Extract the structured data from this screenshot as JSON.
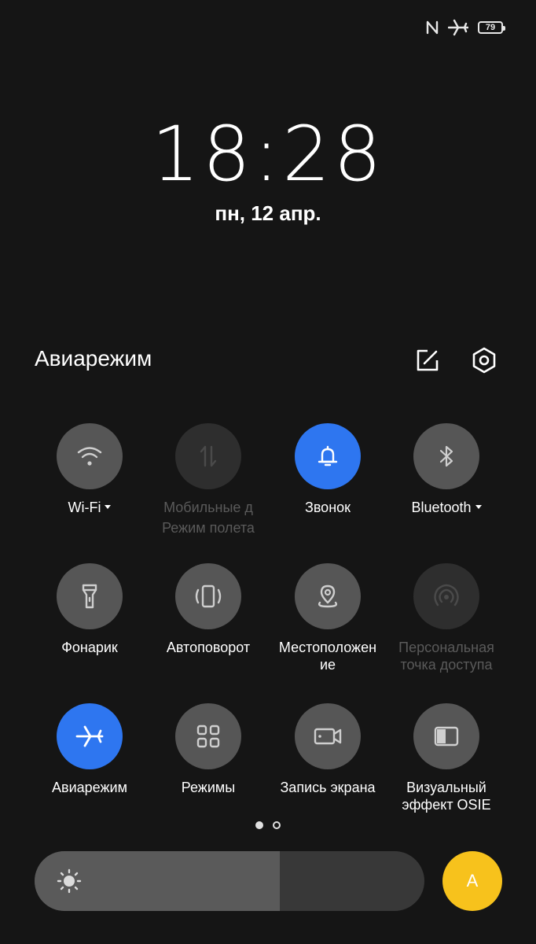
{
  "status_bar": {
    "icons": [
      "nfc-icon",
      "airplane-icon",
      "battery-icon"
    ],
    "battery_level": "79"
  },
  "lockscreen": {
    "time": "18:28",
    "date": "пн, 12 апр."
  },
  "quick_settings": {
    "title": "Авиарежим",
    "header_actions": [
      "edit-icon",
      "settings-icon"
    ],
    "tiles": [
      {
        "label": "Wi-Fi",
        "icon": "wifi-icon",
        "state": "off",
        "dropdown": true
      },
      {
        "label": "Мобильные д",
        "sublabel": "Режим полета",
        "icon": "mobile-data-icon",
        "state": "disabled"
      },
      {
        "label": "Звонок",
        "icon": "bell-icon",
        "state": "on"
      },
      {
        "label": "Bluetooth",
        "icon": "bluetooth-icon",
        "state": "off",
        "dropdown": true
      },
      {
        "label": "Фонарик",
        "icon": "flashlight-icon",
        "state": "off"
      },
      {
        "label": "Автоповорот",
        "icon": "auto-rotate-icon",
        "state": "off"
      },
      {
        "label": "Местоположен",
        "label_line2": "ие",
        "icon": "location-icon",
        "state": "off"
      },
      {
        "label": "Персональная",
        "label_line2": "точка доступа",
        "icon": "hotspot-icon",
        "state": "disabled"
      },
      {
        "label": "Авиарежим",
        "icon": "airplane-icon",
        "state": "on"
      },
      {
        "label": "Режимы",
        "icon": "modes-icon",
        "state": "off"
      },
      {
        "label": "Запись экрана",
        "icon": "screen-record-icon",
        "state": "off"
      },
      {
        "label": "Визуальный",
        "label_line2": "эффект OSIE",
        "icon": "osie-icon",
        "state": "off"
      }
    ],
    "page_indicator": {
      "pages": 2,
      "current": 1
    },
    "brightness": {
      "level": 0.63,
      "icon": "sun-icon"
    },
    "auto_brightness": {
      "label": "A"
    },
    "colors": {
      "active": "#2e76f0",
      "inactive": "#565656",
      "disabled": "#2e2e2e",
      "auto": "#f7c21c"
    }
  }
}
